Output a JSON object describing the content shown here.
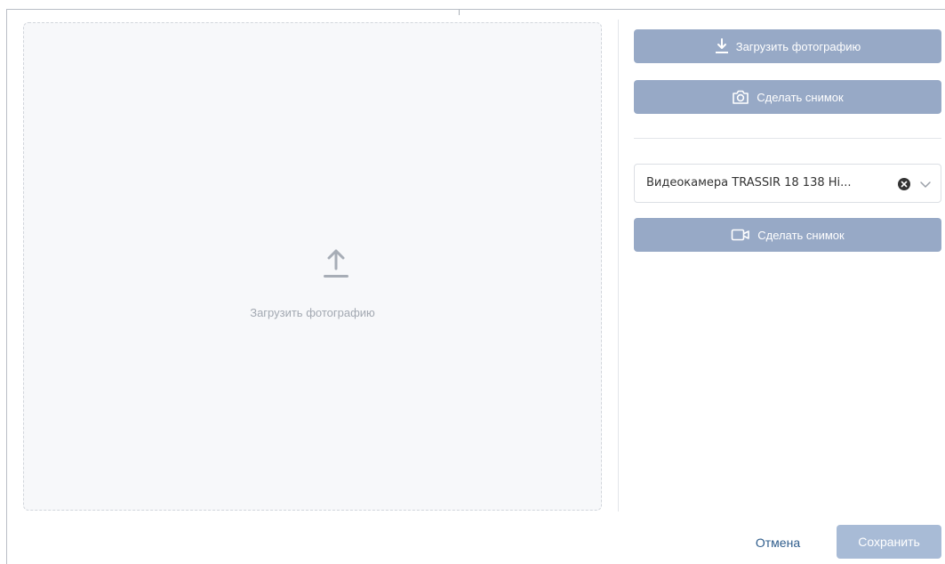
{
  "dropzone": {
    "icon": "upload-icon",
    "label": "Загрузить фотографию"
  },
  "actions": {
    "upload_photo": {
      "icon": "download-icon",
      "label": "Загрузить фотографию"
    },
    "take_snapshot": {
      "icon": "camera-icon",
      "label": "Сделать снимок"
    }
  },
  "camera": {
    "selected": "Видеокамера TRASSIR 18 138 Hi...",
    "clear_icon": "clear-circle-icon",
    "dropdown_icon": "chevron-down-icon",
    "snapshot": {
      "icon": "video-camera-icon",
      "label": "Сделать снимок"
    }
  },
  "footer": {
    "cancel_label": "Отмена",
    "save_label": "Сохранить"
  },
  "colors": {
    "button_bg": "#97a9c6",
    "save_bg": "#a8bbd6",
    "link": "#2f5d8c",
    "dropzone_bg": "#f7f8fa"
  }
}
